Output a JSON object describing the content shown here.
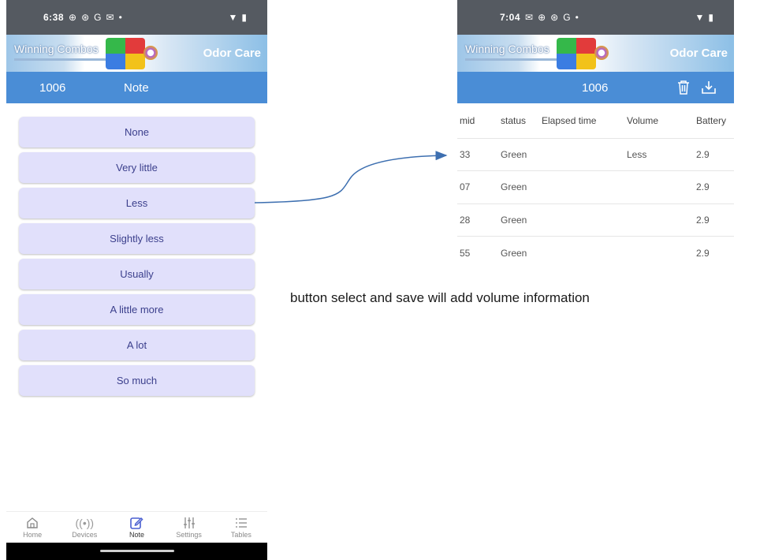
{
  "left_screen": {
    "status": {
      "time": "6:38",
      "icons_left": [
        "⊕",
        "⊛",
        "G",
        "✉",
        "•"
      ],
      "icons_right": [
        "▼",
        "▮"
      ]
    },
    "banner": {
      "brand": "Winning Combos",
      "product": "Odor Care"
    },
    "appbar": {
      "id": "1006",
      "title": "Note"
    },
    "options": [
      "None",
      "Very little",
      "Less",
      "Slightly less",
      "Usually",
      "A little more",
      "A lot",
      "So much"
    ],
    "nav": [
      {
        "label": "Home",
        "icon": "home-icon"
      },
      {
        "label": "Devices",
        "icon": "radio-icon"
      },
      {
        "label": "Note",
        "icon": "edit-icon"
      },
      {
        "label": "Settings",
        "icon": "sliders-icon"
      },
      {
        "label": "Tables",
        "icon": "list-icon"
      }
    ]
  },
  "right_screen": {
    "status": {
      "time": "7:04",
      "icons_left": [
        "✉",
        "⊕",
        "⊛",
        "G",
        "•"
      ],
      "icons_right": [
        "▼",
        "▮"
      ]
    },
    "banner": {
      "brand": "Winning Combos",
      "product": "Odor Care"
    },
    "appbar": {
      "id": "1006"
    },
    "table": {
      "headers": [
        "mid",
        "status",
        "Elapsed time",
        "Volume",
        "Battery"
      ],
      "rows": [
        [
          "33",
          "Green",
          "",
          "Less",
          "2.9"
        ],
        [
          "07",
          "Green",
          "",
          "",
          "2.9"
        ],
        [
          "28",
          "Green",
          "",
          "",
          "2.9"
        ],
        [
          "55",
          "Green",
          "",
          "",
          "2.9"
        ]
      ]
    }
  },
  "annotation": "button select and save will add volume information",
  "colors": {
    "appbar": "#4a8dd6",
    "option_bg": "#e1e0fb",
    "option_text": "#3b3f8c",
    "arrow": "#3d6fb0"
  }
}
